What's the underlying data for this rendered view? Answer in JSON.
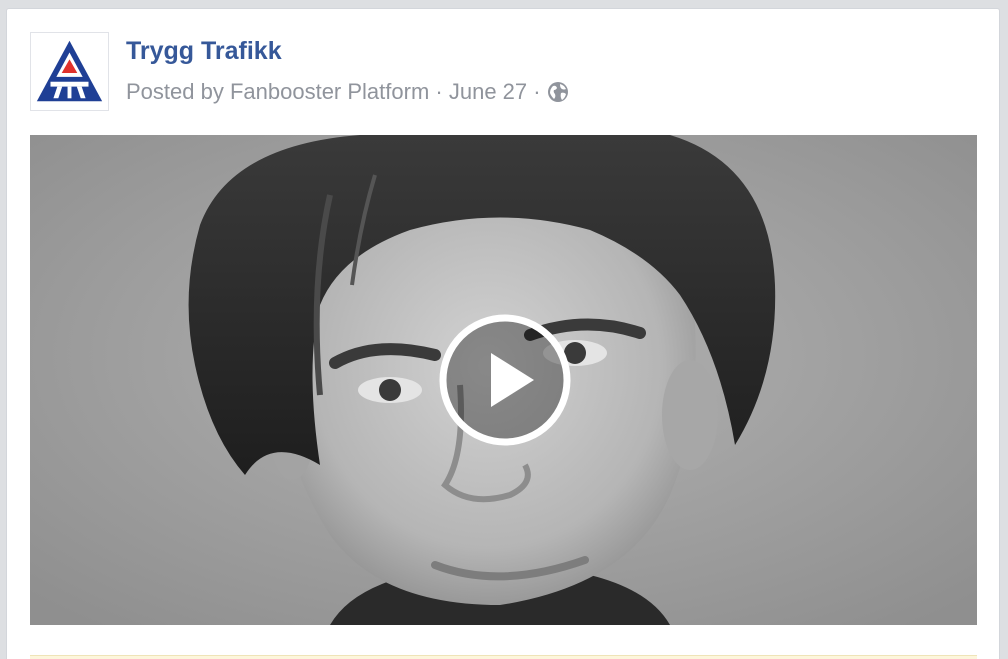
{
  "post": {
    "page_name": "Trygg Trafikk",
    "posted_by_prefix": "Posted by",
    "posted_by_app": "Fanbooster Platform",
    "separator": "·",
    "date": "June 27",
    "privacy_icon": "globe-icon",
    "avatar_logo": "trygg-trafikk-triangle-logo",
    "video": {
      "thumbnail": "black-and-white close-up portrait of a young man",
      "play_icon": "play-icon"
    }
  },
  "colors": {
    "page_name": "#365899",
    "meta_text": "#90949c",
    "logo_blue": "#1f3f95",
    "logo_red": "#e0322c",
    "card_bg": "#ffffff",
    "page_bg": "#dddfe2"
  }
}
